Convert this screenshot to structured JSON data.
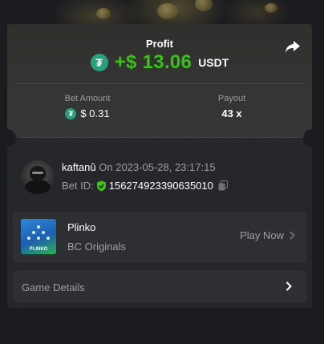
{
  "header": {
    "title": "Profit",
    "amount": "+$ 13.06",
    "currency": "USDT",
    "currency_icon": "usdt-icon",
    "share_icon": "share-icon",
    "amount_color": "#3bc117"
  },
  "stats": {
    "bet_amount_label": "Bet Amount",
    "bet_amount_value": "$ 0.31",
    "payout_label": "Payout",
    "payout_value": "43 x"
  },
  "bet_info": {
    "username": "kaftanû",
    "date_text": "On 2023-05-28, 23:17:15",
    "bet_id_label": "Bet ID:",
    "bet_id": "156274923390635010"
  },
  "game": {
    "name": "Plinko",
    "provider": "BC Originals",
    "thumb_label": "PLINKO",
    "play_label": "Play Now"
  },
  "details": {
    "label": "Game Details"
  }
}
